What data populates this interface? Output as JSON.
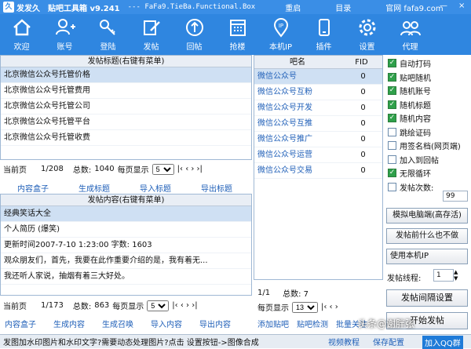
{
  "title": {
    "app": "发发久",
    "name": "贴吧工具箱 v9.241",
    "sub": "--- FaFa9.TieBa.Functional.Box",
    "reload": "重启",
    "dir": "目录",
    "site": "官网 fafa9.com",
    "min": "—",
    "close": "×"
  },
  "toolbar": [
    {
      "label": "欢迎",
      "icon": "home-icon"
    },
    {
      "label": "账号",
      "icon": "add-user-icon"
    },
    {
      "label": "登陆",
      "icon": "key-icon"
    },
    {
      "label": "发帖",
      "icon": "compose-icon"
    },
    {
      "label": "回帖",
      "icon": "upload-icon"
    },
    {
      "label": "抢楼",
      "icon": "grid-icon"
    },
    {
      "label": "本机IP",
      "icon": "ip-pin-icon"
    },
    {
      "label": "插件",
      "icon": "puzzle-icon"
    },
    {
      "label": "设置",
      "icon": "gear-icon"
    },
    {
      "label": "代理",
      "icon": "proxy-icon"
    }
  ],
  "posts": {
    "header": "发帖标题(右键有菜单)",
    "rows": [
      "北京微信公众号托管价格",
      "北京微信公众号托管费用",
      "北京微信公众号托管公司",
      "北京微信公众号托管平台",
      "北京微信公众号托管收费"
    ],
    "pager": {
      "cur_label": "当前页",
      "cur": "1/208",
      "total_label": "总数:",
      "total": "1040",
      "per_label": "每页显示",
      "per": "5"
    },
    "links": [
      "内容盒子",
      "生成标题",
      "导入标题",
      "导出标题"
    ]
  },
  "content": {
    "header": "发帖内容(右键有菜单)",
    "rows": [
      "经典笑话大全",
      "个人简历 (爆笑)",
      "更新时间2007-7-10 1:23:00   字数: 1603",
      "  观众朋友们，首先，我要在此作重要介绍的是，我有着无...",
      "  我还听人家说，抽烟有着三大好处。"
    ],
    "pager": {
      "cur_label": "当前页",
      "cur": "1/173",
      "total_label": "总数:",
      "total": "863",
      "per_label": "每页显示",
      "per": "5"
    },
    "links": [
      "内容盒子",
      "生成内容",
      "生成召唤",
      "导入内容",
      "导出内容"
    ]
  },
  "bars": {
    "header_name": "吧名",
    "header_fid": "FID",
    "rows": [
      {
        "name": "微信公众号",
        "fid": "0"
      },
      {
        "name": "微信公众号互粉",
        "fid": "0"
      },
      {
        "name": "微信公众号开发",
        "fid": "0"
      },
      {
        "name": "微信公众号互推",
        "fid": "0"
      },
      {
        "name": "微信公众号推广",
        "fid": "0"
      },
      {
        "name": "微信公众号运营",
        "fid": "0"
      },
      {
        "name": "微信公众号交易",
        "fid": "0"
      }
    ],
    "pager": {
      "cur": "1/1",
      "total_label": "总数:",
      "total": "7",
      "per_label": "每页显示",
      "per": "13"
    },
    "links": [
      "添加贴吧",
      "贴吧检测",
      "批量关注"
    ]
  },
  "options": [
    {
      "label": "自动打码",
      "on": true
    },
    {
      "label": "贴吧随机",
      "on": true
    },
    {
      "label": "随机账号",
      "on": true
    },
    {
      "label": "随机标题",
      "on": true
    },
    {
      "label": "随机内容",
      "on": true
    },
    {
      "label": "跳绘证码",
      "on": false
    },
    {
      "label": "用签名档(网页端)",
      "on": false
    },
    {
      "label": "加入到回帖",
      "on": false
    },
    {
      "label": "无限循环",
      "on": true
    },
    {
      "label": "发帖次数:",
      "on": false
    }
  ],
  "post_count": "99",
  "selects": [
    "模拟电脑端(高存活)",
    "发帖前什么也不做",
    "使用本机IP"
  ],
  "threads_label": "发帖线程:",
  "threads": "1",
  "interval_btn": "发帖间隔设置",
  "start_btn": "开始发帖",
  "status": {
    "text": "发图加水印图片和水印文字?需要动态处理图片?点击 设置按钮->图像合成",
    "video": "视频教程",
    "save": "保存配置",
    "qq": "加入QQ群",
    "watermark": "头条@谢胖张"
  },
  "colors": {
    "toolbar": "#2f86e0",
    "link": "#1f5fb8",
    "check": "#2fa04a"
  }
}
